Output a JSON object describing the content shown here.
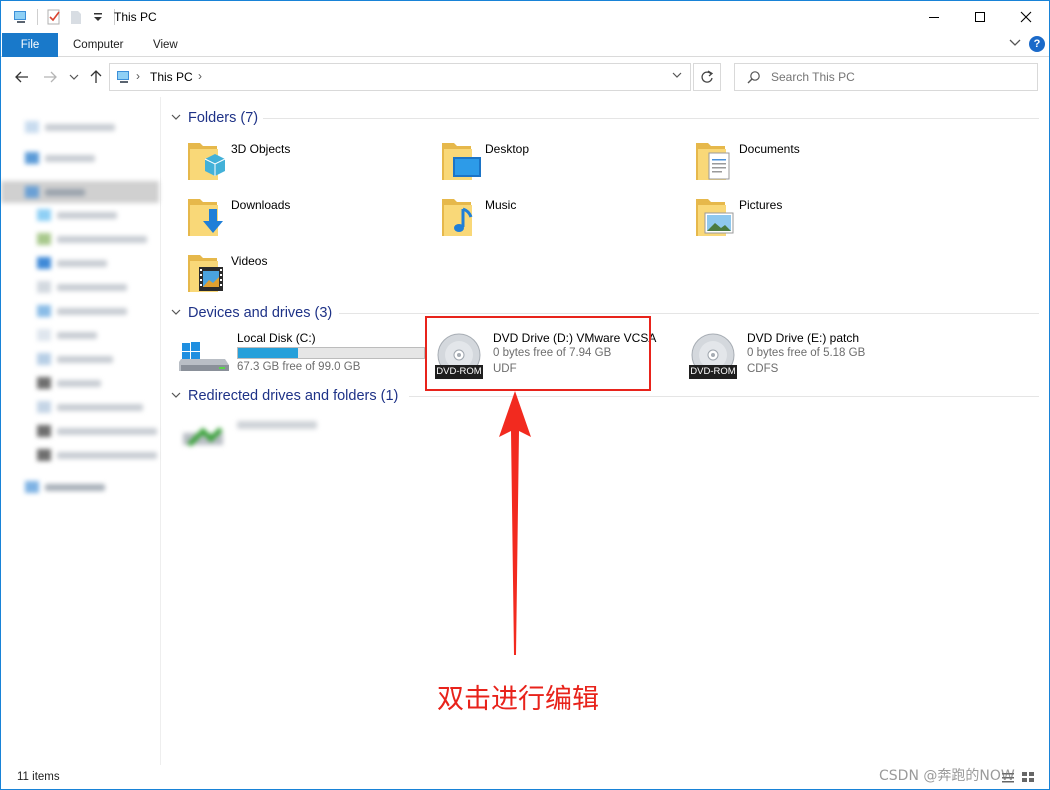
{
  "window": {
    "title": "This PC",
    "accent": "#1979ca"
  },
  "ribbon": {
    "tabs": [
      "File",
      "Computer",
      "View"
    ]
  },
  "address": {
    "crumb": "This PC"
  },
  "search": {
    "placeholder": "Search This PC"
  },
  "groups": {
    "folders": "Folders (7)",
    "devices": "Devices and drives (3)",
    "redirected": "Redirected drives and folders (1)"
  },
  "folders": [
    {
      "label": "3D Objects",
      "icon": "3d-objects-folder-icon"
    },
    {
      "label": "Desktop",
      "icon": "desktop-folder-icon"
    },
    {
      "label": "Documents",
      "icon": "documents-folder-icon"
    },
    {
      "label": "Downloads",
      "icon": "downloads-folder-icon"
    },
    {
      "label": "Music",
      "icon": "music-folder-icon"
    },
    {
      "label": "Pictures",
      "icon": "pictures-folder-icon"
    },
    {
      "label": "Videos",
      "icon": "videos-folder-icon"
    }
  ],
  "drives": [
    {
      "name": "Local Disk (C:)",
      "free": "67.3 GB free of 99.0 GB",
      "used_fraction": 0.32,
      "icon": "windows-drive-icon"
    },
    {
      "name": "DVD Drive (D:) VMware VCSA",
      "free": "0 bytes free of 7.94 GB",
      "fs": "UDF",
      "tag": "DVD-ROM",
      "icon": "dvd-drive-icon"
    },
    {
      "name": "DVD Drive (E:) patch",
      "free": "0 bytes free of 5.18 GB",
      "fs": "CDFS",
      "tag": "DVD-ROM",
      "icon": "dvd-drive-icon"
    }
  ],
  "annotation": {
    "text": "双击进行编辑",
    "color": "#e8231b"
  },
  "status": {
    "count": "11 items"
  },
  "watermark": "CSDN @奔跑的NOW"
}
